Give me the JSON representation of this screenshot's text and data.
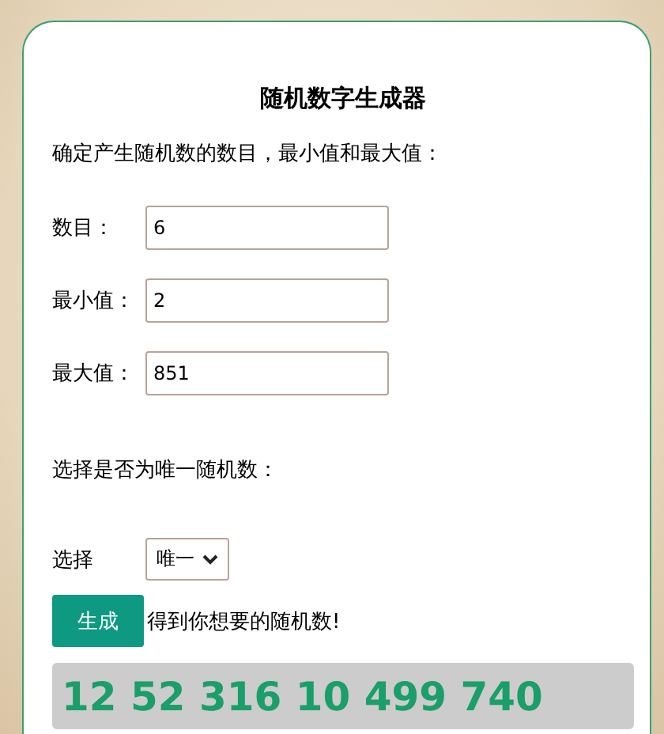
{
  "title": "随机数字生成器",
  "instruction": "确定产生随机数的数目，最小值和最大值：",
  "fields": [
    {
      "label": "数目：",
      "value": "6"
    },
    {
      "label": "最小值：",
      "value": "2"
    },
    {
      "label": "最大值：",
      "value": "851"
    }
  ],
  "unique_prompt": "选择是否为唯一随机数：",
  "choice": {
    "label": "选择",
    "value": "唯一"
  },
  "generate_button": "生成",
  "generate_hint": "得到你想要的随机数!",
  "result": "12 52 316 10 499 740"
}
